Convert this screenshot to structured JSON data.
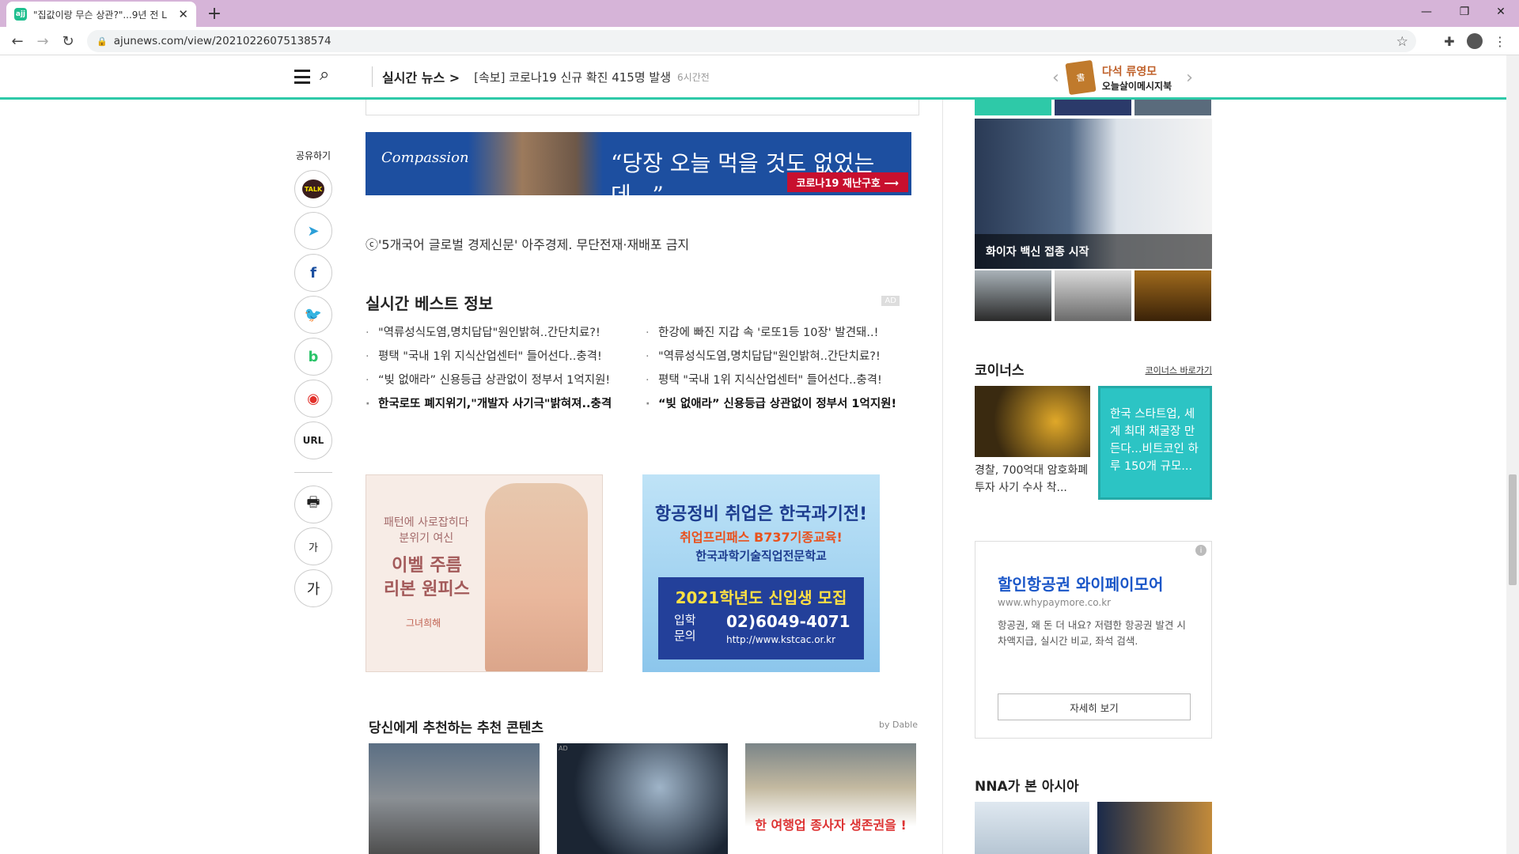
{
  "browser": {
    "tab_title": "\"집값이랑 무슨 상관?\"...9년 전 L",
    "favicon_text": "ajj",
    "url": "ajunews.com/view/20210226075138574"
  },
  "site": {
    "live_label": "실시간 뉴스 >",
    "live_headline": "[속보] 코로나19 신규 확진 415명 발생",
    "live_time": "6시간전",
    "promo_title": "다석 류영모",
    "promo_sub": "오늘살이메시지북"
  },
  "share": {
    "label": "공유하기",
    "buttons": [
      "TALK",
      "telegram",
      "facebook",
      "twitter",
      "band",
      "weibo",
      "URL"
    ],
    "url_label": "URL",
    "font_small": "가",
    "font_large": "가"
  },
  "banner": {
    "logo": "Compassion",
    "quote": "“당장 오늘 먹을 것도 없었는데...”",
    "button": "코로나19 재난구호 ⟶"
  },
  "article": {
    "copyright": "ⓒ'5개국어 글로벌 경제신문' 아주경제. 무단전재·재배포 금지"
  },
  "best": {
    "title": "실시간 베스트 정보",
    "ad": "AD",
    "left": [
      "\"역류성식도염,명치답답\"원인밝혀..간단치료?!",
      "평택 \"국내 1위 지식산업센터\" 들어선다..충격!",
      "“빚 없애라” 신용등급 상관없이 정부서 1억지원!",
      "한국로또 폐지위기,\"개발자 사기극\"밝혀져..충격"
    ],
    "right": [
      "한강에 빠진 지갑 속 '로또1등 10장' 발견돼..!",
      "\"역류성식도염,명치답답\"원인밝혀..간단치료?!",
      "평택 \"국내 1위 지식산업센터\" 들어선다..충격!",
      "“빚 없애라” 신용등급 상관없이 정부서 1억지원!"
    ]
  },
  "ad_dress": {
    "line1": "패턴에 사로잡히다",
    "line2": "분위기 여신",
    "line3": "이벨 주름",
    "line4": "리본 원피스",
    "brand": "그녀희해"
  },
  "ad_school": {
    "line1": "항공정비 취업은 한국과기전!",
    "line2": "취업프리패스 B737기종교육!",
    "line3": "한국과학기술직업전문학교",
    "panel_title": "2021학년도 신입생 모집",
    "panel_label": "입학\n문의",
    "panel_phone": "02)6049-4071",
    "panel_url": "http://www.kstcac.or.kr"
  },
  "recommend": {
    "title": "당신에게 추천하는 추천 콘텐츠",
    "by": "by Dable",
    "ad": "AD",
    "img3_text": "한 여행업 종사자 생존권을 !"
  },
  "right": {
    "gallery_caption": "화이자 백신 접종 시작",
    "coin_title": "코이너스",
    "coin_link": "코이너스 바로가기",
    "coin_left": "경찰, 700억대 암호화폐 투자 사기 수사 착...",
    "coin_right": "한국 스타트업, 세계 최대 채굴장 만든다...비트코인 하루 150개 규모...",
    "whypay_title": "할인항공권 와이페이모어",
    "whypay_url": "www.whypaymore.co.kr",
    "whypay_desc": "항공권, 왜 돈 더 내요? 저렴한 항공권 발견 시 차액지급, 실시간 비교, 좌석 검색.",
    "whypay_button": "자세히 보기",
    "nna_title": "NNA가 본 아시아"
  }
}
